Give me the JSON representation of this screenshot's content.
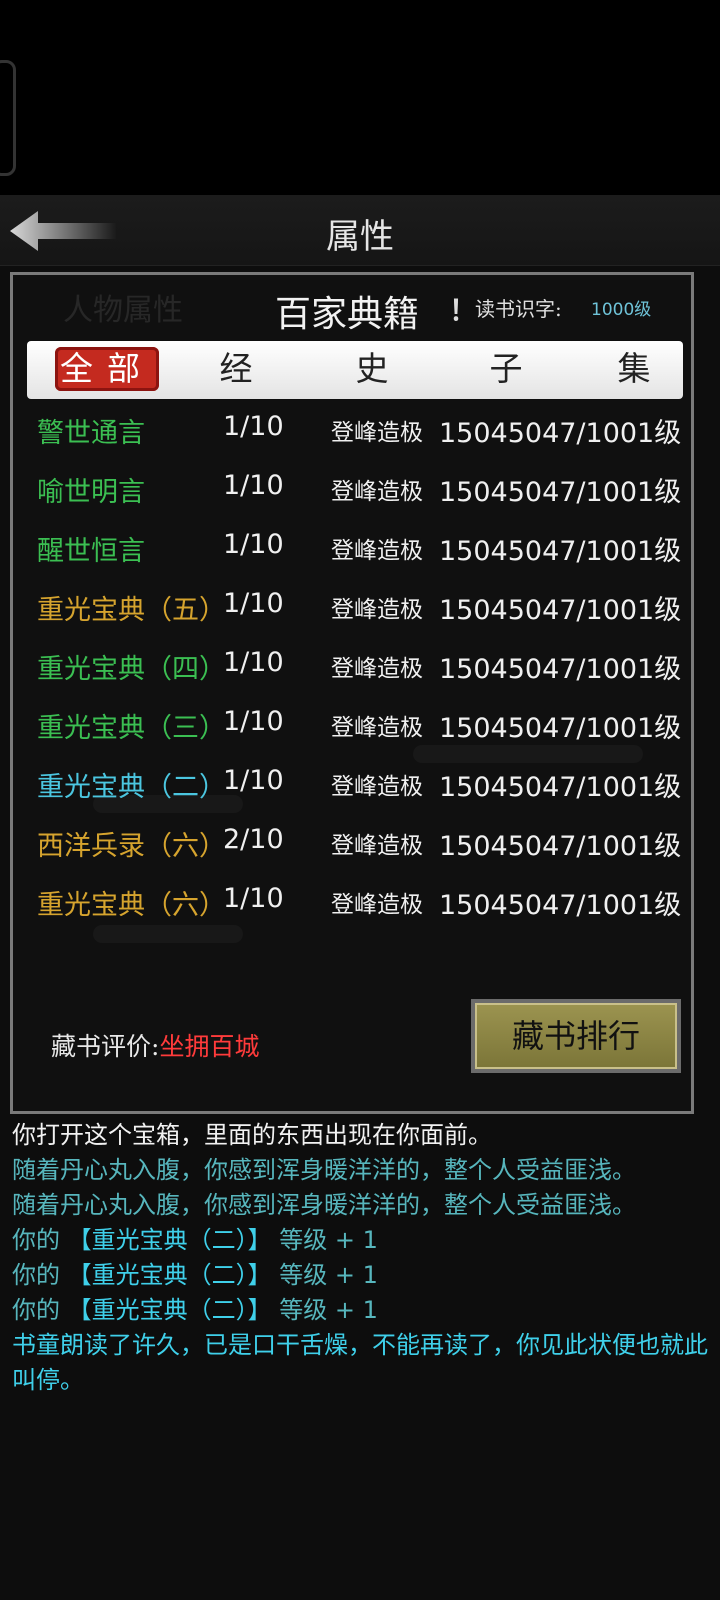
{
  "header": {
    "title": "属性",
    "back_icon": "back-arrow-icon"
  },
  "panel": {
    "title": "百家典籍",
    "bang": "！",
    "literacy_label": "读书识字:",
    "literacy_value": "1000级",
    "tabs": [
      {
        "label": "全部",
        "active": true
      },
      {
        "label": "经",
        "active": false
      },
      {
        "label": "史",
        "active": false
      },
      {
        "label": "子",
        "active": false
      },
      {
        "label": "集",
        "active": false
      }
    ],
    "books": [
      {
        "name": "警世通言",
        "progress": "1/10",
        "rank": "登峰造极",
        "exp": "15045047/1001级",
        "color": "green"
      },
      {
        "name": "喻世明言",
        "progress": "1/10",
        "rank": "登峰造极",
        "exp": "15045047/1001级",
        "color": "green"
      },
      {
        "name": "醒世恒言",
        "progress": "1/10",
        "rank": "登峰造极",
        "exp": "15045047/1001级",
        "color": "green"
      },
      {
        "name": "重光宝典（五）",
        "progress": "1/10",
        "rank": "登峰造极",
        "exp": "15045047/1001级",
        "color": "gold"
      },
      {
        "name": "重光宝典（四）",
        "progress": "1/10",
        "rank": "登峰造极",
        "exp": "15045047/1001级",
        "color": "green"
      },
      {
        "name": "重光宝典（三）",
        "progress": "1/10",
        "rank": "登峰造极",
        "exp": "15045047/1001级",
        "color": "green"
      },
      {
        "name": "重光宝典（二）",
        "progress": "1/10",
        "rank": "登峰造极",
        "exp": "15045047/1001级",
        "color": "cyan"
      },
      {
        "name": "西洋兵录（六）",
        "progress": "2/10",
        "rank": "登峰造极",
        "exp": "15045047/1001级",
        "color": "gold"
      },
      {
        "name": "重光宝典（六）",
        "progress": "1/10",
        "rank": "登峰造极",
        "exp": "15045047/1001级",
        "color": "gold"
      }
    ],
    "evaluation_label": "藏书评价:",
    "evaluation_value": "坐拥百城",
    "ranking_button": "藏书排行"
  },
  "log": {
    "l1": "你打开这个宝箱，里面的东西出现在你面前。",
    "l2": "随着丹心丸入腹，你感到浑身暖洋洋的，整个人受益匪浅。",
    "l3": "随着丹心丸入腹，你感到浑身暖洋洋的，整个人受益匪浅。",
    "l4_a": "你的",
    "l4_b": "【重光宝典（二）】",
    "l4_c": "等级 + 1",
    "l5_a": "你的",
    "l5_b": "【重光宝典（二）】",
    "l5_c": "等级 + 1",
    "l6_a": "你的",
    "l6_b": "【重光宝典（二）】",
    "l6_c": "等级 + 1",
    "l7": "书童朗读了许久，已是口干舌燥，不能再读了，你见此状便也就此叫停。"
  }
}
